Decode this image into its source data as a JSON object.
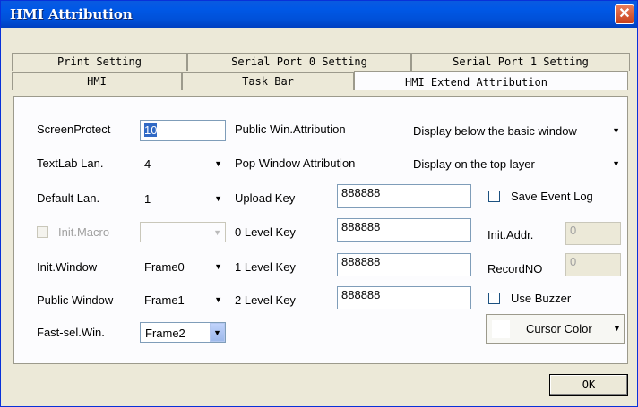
{
  "window": {
    "title": "HMI Attribution",
    "close_glyph": "✕"
  },
  "tabs": {
    "back_row": [
      "Print Setting",
      "Serial Port 0 Setting",
      "Serial Port 1 Setting"
    ],
    "front_row": [
      "HMI",
      "Task Bar",
      "HMI Extend Attribution"
    ],
    "active": "HMI Extend Attribution"
  },
  "left": {
    "screen_protect": {
      "label": "ScreenProtect",
      "value": "10"
    },
    "textlab_lan": {
      "label": "TextLab Lan.",
      "value": "4"
    },
    "default_lan": {
      "label": "Default Lan.",
      "value": "1"
    },
    "init_macro": {
      "label": "Init.Macro",
      "value": "",
      "checked": false,
      "enabled": false
    },
    "init_window": {
      "label": "Init.Window",
      "value": "Frame0"
    },
    "public_window": {
      "label": "Public Window",
      "value": "Frame1"
    },
    "fast_sel_win": {
      "label": "Fast-sel.Win.",
      "value": "Frame2"
    }
  },
  "middle": {
    "public_win_attr": {
      "label": "Public Win.Attribution",
      "value": "Display below the basic window"
    },
    "pop_window_attr": {
      "label": "Pop Window Attribution",
      "value": "Display on the top layer"
    },
    "upload_key": {
      "label": "Upload Key",
      "value": "888888"
    },
    "level0_key": {
      "label": "0 Level Key",
      "value": "888888"
    },
    "level1_key": {
      "label": "1 Level Key",
      "value": "888888"
    },
    "level2_key": {
      "label": "2 Level Key",
      "value": "888888"
    }
  },
  "right": {
    "save_event_log": {
      "label": "Save Event Log",
      "checked": false
    },
    "init_addr": {
      "label": "Init.Addr.",
      "value": "0",
      "enabled": false
    },
    "record_no": {
      "label": "RecordNO",
      "value": "0",
      "enabled": false
    },
    "use_buzzer": {
      "label": "Use Buzzer",
      "checked": false
    },
    "cursor_color": {
      "label": "Cursor Color",
      "swatch": "#ffffff"
    }
  },
  "footer": {
    "ok_label": "OK"
  },
  "icons": {
    "dropdown": "▼",
    "close": "close-icon"
  }
}
